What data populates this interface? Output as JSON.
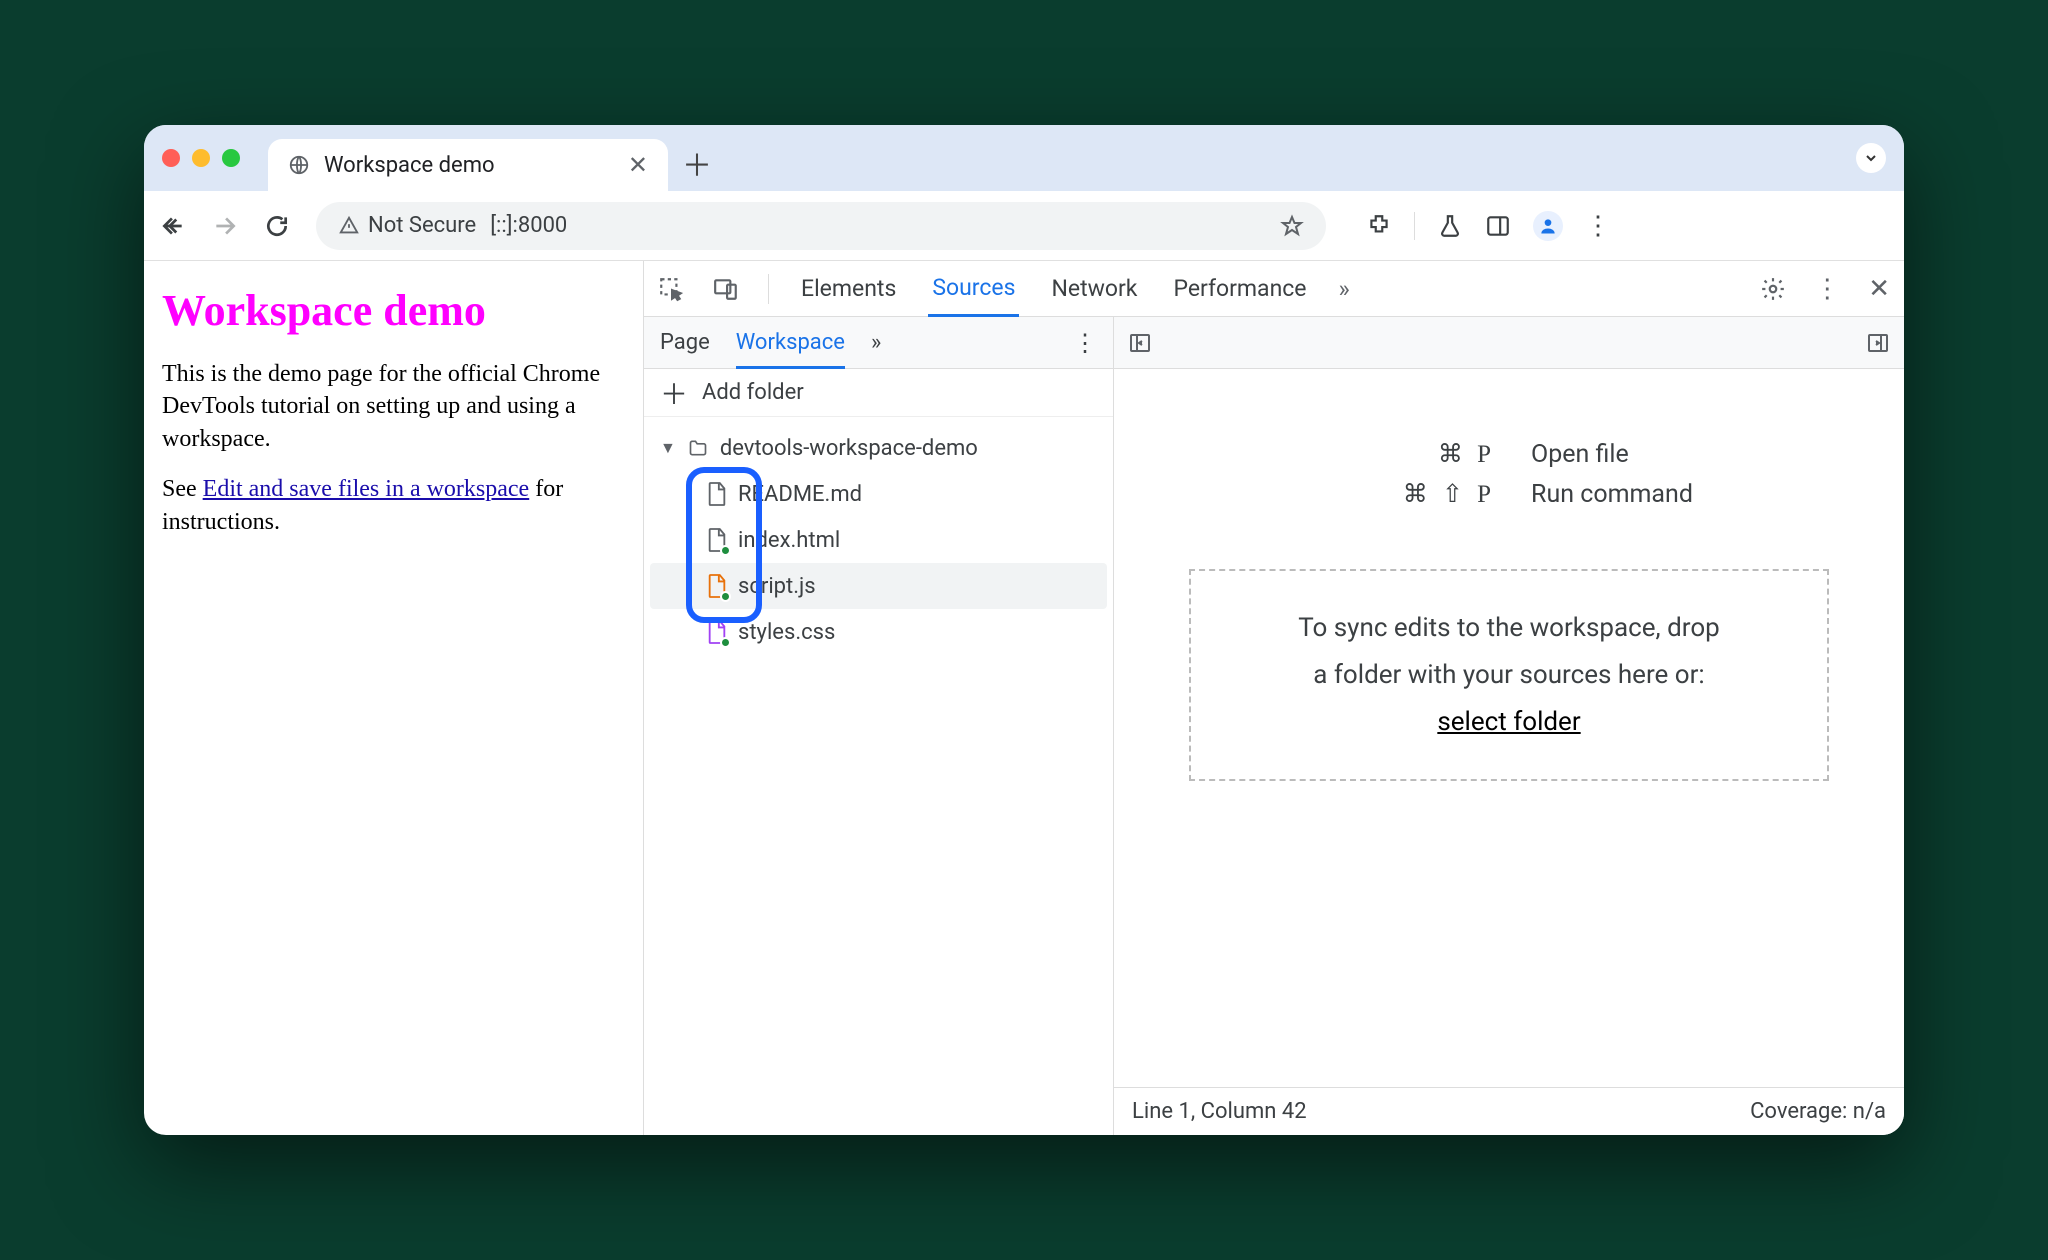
{
  "browser": {
    "tab_title": "Workspace demo",
    "not_secure_label": "Not Secure",
    "url": "[::]:8000"
  },
  "page": {
    "heading": "Workspace demo",
    "p1": "This is the demo page for the official Chrome DevTools tutorial on setting up and using a workspace.",
    "p2_pre": "See ",
    "p2_link": "Edit and save files in a workspace",
    "p2_post": " for instructions."
  },
  "devtools": {
    "tabs": {
      "elements": "Elements",
      "sources": "Sources",
      "network": "Network",
      "performance": "Performance"
    },
    "subtabs": {
      "page": "Page",
      "workspace": "Workspace"
    },
    "add_folder": "Add folder",
    "tree": {
      "root": "devtools-workspace-demo",
      "files": [
        {
          "name": "README.md",
          "type": "generic",
          "mapped": false
        },
        {
          "name": "index.html",
          "type": "html",
          "mapped": true
        },
        {
          "name": "script.js",
          "type": "js",
          "mapped": true
        },
        {
          "name": "styles.css",
          "type": "css",
          "mapped": true
        }
      ]
    },
    "shortcuts": {
      "open_file_keys": "⌘ P",
      "open_file_label": "Open file",
      "run_cmd_keys": "⌘ ⇧ P",
      "run_cmd_label": "Run command"
    },
    "dropzone": {
      "line1": "To sync edits to the workspace, drop",
      "line2": "a folder with your sources here or:",
      "link": "select folder"
    },
    "status": {
      "pos": "Line 1, Column 42",
      "coverage": "Coverage: n/a"
    }
  }
}
